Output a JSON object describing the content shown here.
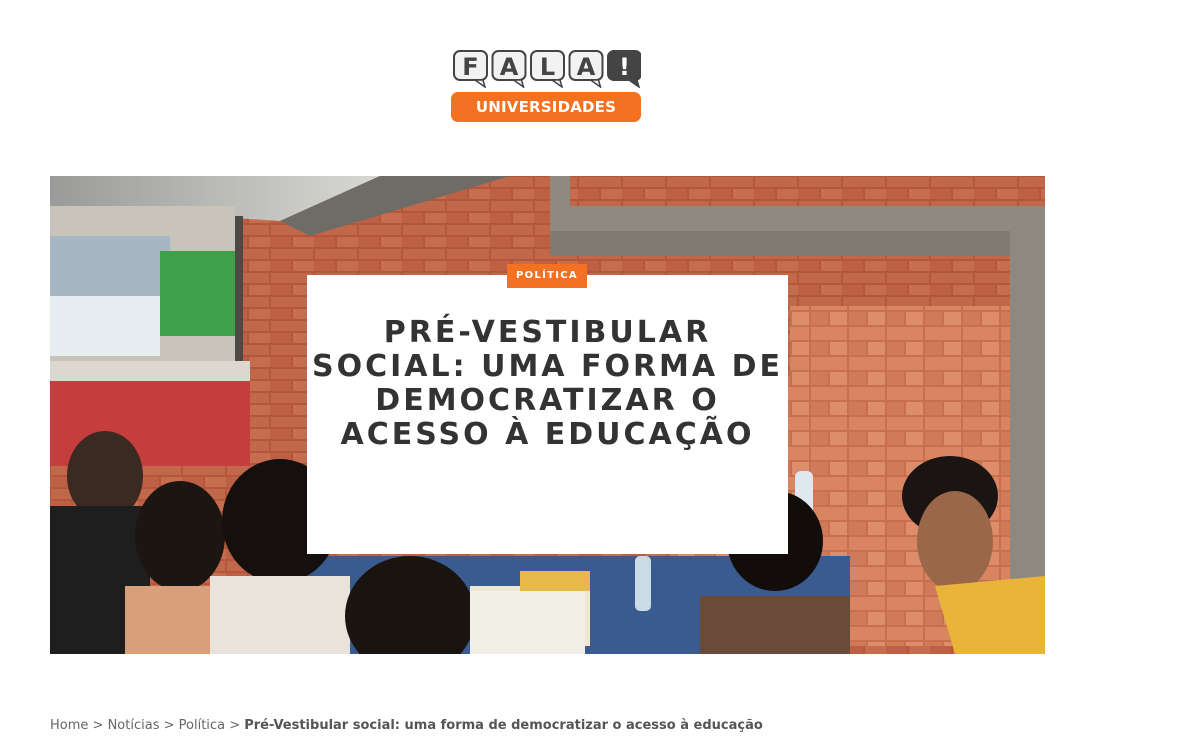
{
  "brand": {
    "logo_letters": [
      "F",
      "A",
      "L",
      "A",
      "!"
    ],
    "logo_tagline": "UNIVERSIDADES",
    "accent_color": "#f47121",
    "bubble_color": "#f2f2f2",
    "bubble_stroke": "#444444"
  },
  "article": {
    "category": "POLÍTICA",
    "title": "PRÉ-VESTIBULAR SOCIAL: UMA FORMA DE DEMOCRATIZAR O ACESSO À EDUCAÇÃO",
    "title_color": "#333333"
  },
  "breadcrumb": {
    "separator": ">",
    "items": [
      {
        "label": "Home"
      },
      {
        "label": "Notícias"
      },
      {
        "label": "Política"
      }
    ],
    "current": "Pré-Vestibular social: uma forma de democratizar o acesso à educação"
  }
}
